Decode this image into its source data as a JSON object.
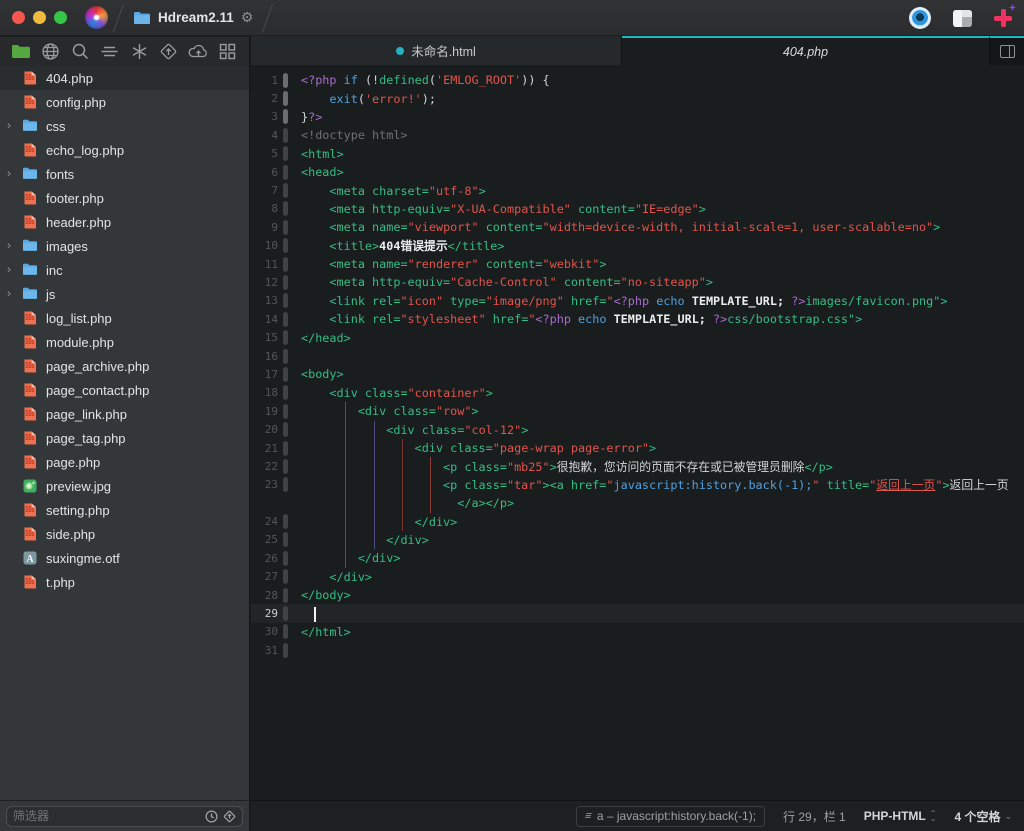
{
  "titlebar": {
    "project_name": "Hdream2.11",
    "window_buttons": [
      "close",
      "minimize",
      "zoom"
    ],
    "right_icons": [
      "preview-eye-icon",
      "layout-panels-icon",
      "xray-plus-icon"
    ]
  },
  "toolbar": {
    "icons": [
      "folder",
      "globe",
      "search",
      "lines",
      "asterisk",
      "diamond-arrow",
      "cloud-upload",
      "grid"
    ]
  },
  "tabs": [
    {
      "label": "未命名.html",
      "modified": true,
      "active": false
    },
    {
      "label": "404.php",
      "modified": false,
      "active": true
    }
  ],
  "sidebar": {
    "filter_placeholder": "筛选器",
    "items": [
      {
        "label": "404.php",
        "icon": "php",
        "selected": true
      },
      {
        "label": "config.php",
        "icon": "php",
        "selected": false
      },
      {
        "label": "css",
        "icon": "folder",
        "selected": false
      },
      {
        "label": "echo_log.php",
        "icon": "php",
        "selected": false
      },
      {
        "label": "fonts",
        "icon": "folder",
        "selected": false
      },
      {
        "label": "footer.php",
        "icon": "php",
        "selected": false
      },
      {
        "label": "header.php",
        "icon": "php",
        "selected": false
      },
      {
        "label": "images",
        "icon": "folder",
        "selected": false
      },
      {
        "label": "inc",
        "icon": "folder",
        "selected": false
      },
      {
        "label": "js",
        "icon": "folder",
        "selected": false
      },
      {
        "label": "log_list.php",
        "icon": "php",
        "selected": false
      },
      {
        "label": "module.php",
        "icon": "php",
        "selected": false
      },
      {
        "label": "page_archive.php",
        "icon": "php",
        "selected": false
      },
      {
        "label": "page_contact.php",
        "icon": "php",
        "selected": false
      },
      {
        "label": "page_link.php",
        "icon": "php",
        "selected": false
      },
      {
        "label": "page_tag.php",
        "icon": "php",
        "selected": false
      },
      {
        "label": "page.php",
        "icon": "php",
        "selected": false
      },
      {
        "label": "preview.jpg",
        "icon": "image",
        "selected": false
      },
      {
        "label": "setting.php",
        "icon": "php",
        "selected": false
      },
      {
        "label": "side.php",
        "icon": "php",
        "selected": false
      },
      {
        "label": "suxingme.otf",
        "icon": "font",
        "selected": false
      },
      {
        "label": "t.php",
        "icon": "php",
        "selected": false
      }
    ]
  },
  "editor": {
    "cursor": {
      "row": 30,
      "col": 0
    },
    "bright_pill_rows": [
      1,
      2,
      3
    ],
    "indent_guides": [
      {
        "col": 4,
        "from_row": 19,
        "to_row": 27,
        "color": "#3a5a85"
      },
      {
        "col": 8,
        "from_row": 20,
        "to_row": 26,
        "color": "#4c4a84"
      },
      {
        "col": 12,
        "from_row": 21,
        "to_row": 25,
        "color": "#7c3531"
      },
      {
        "col": 16,
        "from_row": 22,
        "to_row": 24,
        "color": "#8e3d37"
      }
    ],
    "rows": [
      {
        "n": 1,
        "t": [
          [
            "p",
            "<?php"
          ],
          [
            "w",
            " "
          ],
          [
            "k",
            "if"
          ],
          [
            "w",
            " (!"
          ],
          [
            "t",
            "defined"
          ],
          [
            "w",
            "("
          ],
          [
            "s",
            "'EMLOG_ROOT'"
          ],
          [
            "w",
            ")) {"
          ]
        ]
      },
      {
        "n": 2,
        "t": [
          [
            "w",
            "    "
          ],
          [
            "k",
            "exit"
          ],
          [
            "w",
            "("
          ],
          [
            "s",
            "'error!'"
          ],
          [
            "w",
            ");"
          ]
        ]
      },
      {
        "n": 3,
        "t": [
          [
            "w",
            "}"
          ],
          [
            "p",
            "?>"
          ]
        ]
      },
      {
        "n": 4,
        "t": [
          [
            "g",
            "<!doctype html>"
          ]
        ]
      },
      {
        "n": 5,
        "t": [
          [
            "t",
            "<html>"
          ]
        ]
      },
      {
        "n": 6,
        "t": [
          [
            "t",
            "<head>"
          ]
        ]
      },
      {
        "n": 7,
        "t": [
          [
            "w",
            "    "
          ],
          [
            "t",
            "<meta charset="
          ],
          [
            "s",
            "\"utf-8\""
          ],
          [
            "t",
            ">"
          ]
        ]
      },
      {
        "n": 8,
        "t": [
          [
            "w",
            "    "
          ],
          [
            "t",
            "<meta http-equiv="
          ],
          [
            "s",
            "\"X-UA-Compatible\""
          ],
          [
            "t",
            " content="
          ],
          [
            "s",
            "\"IE=edge\""
          ],
          [
            "t",
            ">"
          ]
        ]
      },
      {
        "n": 9,
        "t": [
          [
            "w",
            "    "
          ],
          [
            "t",
            "<meta name="
          ],
          [
            "s",
            "\"viewport\""
          ],
          [
            "t",
            " content="
          ],
          [
            "s",
            "\"width=device-width, initial-scale=1, user-scalable=no\""
          ],
          [
            "t",
            ">"
          ]
        ]
      },
      {
        "n": 10,
        "t": [
          [
            "w",
            "    "
          ],
          [
            "t",
            "<title>"
          ],
          [
            "b",
            "404错误提示"
          ],
          [
            "t",
            "</title>"
          ]
        ]
      },
      {
        "n": 11,
        "t": [
          [
            "w",
            "    "
          ],
          [
            "t",
            "<meta name="
          ],
          [
            "s",
            "\"renderer\""
          ],
          [
            "t",
            " content="
          ],
          [
            "s",
            "\"webkit\""
          ],
          [
            "t",
            ">"
          ]
        ]
      },
      {
        "n": 12,
        "t": [
          [
            "w",
            "    "
          ],
          [
            "t",
            "<meta http-equiv="
          ],
          [
            "s",
            "\"Cache-Control\""
          ],
          [
            "t",
            " content="
          ],
          [
            "s",
            "\"no-siteapp\""
          ],
          [
            "t",
            ">"
          ]
        ]
      },
      {
        "n": 13,
        "t": [
          [
            "w",
            "    "
          ],
          [
            "t",
            "<link rel="
          ],
          [
            "s",
            "\"icon\""
          ],
          [
            "t",
            " type="
          ],
          [
            "s",
            "\"image/png\""
          ],
          [
            "t",
            " href="
          ],
          [
            "s",
            "\""
          ],
          [
            "p",
            "<?php"
          ],
          [
            "w",
            " "
          ],
          [
            "k",
            "echo"
          ],
          [
            "w",
            " "
          ],
          [
            "b",
            "TEMPLATE_URL;"
          ],
          [
            "w",
            " "
          ],
          [
            "p",
            "?>"
          ],
          [
            "t",
            "images/favicon.png\">"
          ]
        ]
      },
      {
        "n": 14,
        "t": [
          [
            "w",
            "    "
          ],
          [
            "t",
            "<link rel="
          ],
          [
            "s",
            "\"stylesheet\""
          ],
          [
            "t",
            " href="
          ],
          [
            "s",
            "\""
          ],
          [
            "p",
            "<?php"
          ],
          [
            "w",
            " "
          ],
          [
            "k",
            "echo"
          ],
          [
            "w",
            " "
          ],
          [
            "b",
            "TEMPLATE_URL;"
          ],
          [
            "w",
            " "
          ],
          [
            "p",
            "?>"
          ],
          [
            "t",
            "css/bootstrap.css\">"
          ]
        ]
      },
      {
        "n": 15,
        "t": [
          [
            "t",
            "</head>"
          ]
        ]
      },
      {
        "n": 16,
        "t": []
      },
      {
        "n": 17,
        "t": [
          [
            "t",
            "<body>"
          ]
        ]
      },
      {
        "n": 18,
        "t": [
          [
            "w",
            "    "
          ],
          [
            "t",
            "<div class="
          ],
          [
            "s",
            "\"container\""
          ],
          [
            "t",
            ">"
          ]
        ]
      },
      {
        "n": 19,
        "t": [
          [
            "w",
            "        "
          ],
          [
            "t",
            "<div class="
          ],
          [
            "s",
            "\"row\""
          ],
          [
            "t",
            ">"
          ]
        ]
      },
      {
        "n": 20,
        "t": [
          [
            "w",
            "            "
          ],
          [
            "t",
            "<div class="
          ],
          [
            "s",
            "\"col-12\""
          ],
          [
            "t",
            ">"
          ]
        ]
      },
      {
        "n": 21,
        "t": [
          [
            "w",
            "                "
          ],
          [
            "t",
            "<div class="
          ],
          [
            "s",
            "\"page-wrap page-error\""
          ],
          [
            "t",
            ">"
          ]
        ]
      },
      {
        "n": 22,
        "t": [
          [
            "w",
            "                    "
          ],
          [
            "t",
            "<p class="
          ],
          [
            "s",
            "\"mb25\""
          ],
          [
            "t",
            ">"
          ],
          [
            "w",
            "很抱歉，您访问的页面不存在或已被管理员删除"
          ],
          [
            "t",
            "</p>"
          ]
        ]
      },
      {
        "n": 23,
        "t": [
          [
            "w",
            "                    "
          ],
          [
            "t",
            "<p class="
          ],
          [
            "s",
            "\"tar\""
          ],
          [
            "t",
            "><a href="
          ],
          [
            "s",
            "\""
          ],
          [
            "l",
            "javascript:history.back(-1);"
          ],
          [
            "s",
            "\""
          ],
          [
            "t",
            " title="
          ],
          [
            "s",
            "\""
          ],
          [
            "u",
            "返回上一页"
          ],
          [
            "s",
            "\""
          ],
          [
            "t",
            ">"
          ],
          [
            "w",
            "返回上一页"
          ]
        ]
      },
      {
        "n": null,
        "t": [
          [
            "w",
            "                      "
          ],
          [
            "t",
            "</a></p>"
          ]
        ]
      },
      {
        "n": 24,
        "t": [
          [
            "w",
            "                "
          ],
          [
            "t",
            "</div>"
          ]
        ]
      },
      {
        "n": 25,
        "t": [
          [
            "w",
            "            "
          ],
          [
            "t",
            "</div>"
          ]
        ]
      },
      {
        "n": 26,
        "t": [
          [
            "w",
            "        "
          ],
          [
            "t",
            "</div>"
          ]
        ]
      },
      {
        "n": 27,
        "t": [
          [
            "w",
            "    "
          ],
          [
            "t",
            "</div>"
          ]
        ]
      },
      {
        "n": 28,
        "t": [
          [
            "t",
            "</body>"
          ]
        ]
      },
      {
        "n": 29,
        "t": [],
        "cursor": true
      },
      {
        "n": 30,
        "t": [
          [
            "t",
            "</html>"
          ]
        ]
      },
      {
        "n": 31,
        "t": []
      }
    ]
  },
  "statusbar": {
    "breadcrumb": "a – javascript:history.back(-1);",
    "position": "行 29，栏 1",
    "syntax_mode": "PHP-HTML",
    "indent_setting": "4 个空格"
  },
  "colors": {
    "accent_teal": "#1fb6c6",
    "editor_bg": "#1a1d1e",
    "tag_green": "#35bd85",
    "string_red": "#e2544c",
    "keyword_blue": "#4fa0e0",
    "php_purple": "#a96bd0"
  }
}
